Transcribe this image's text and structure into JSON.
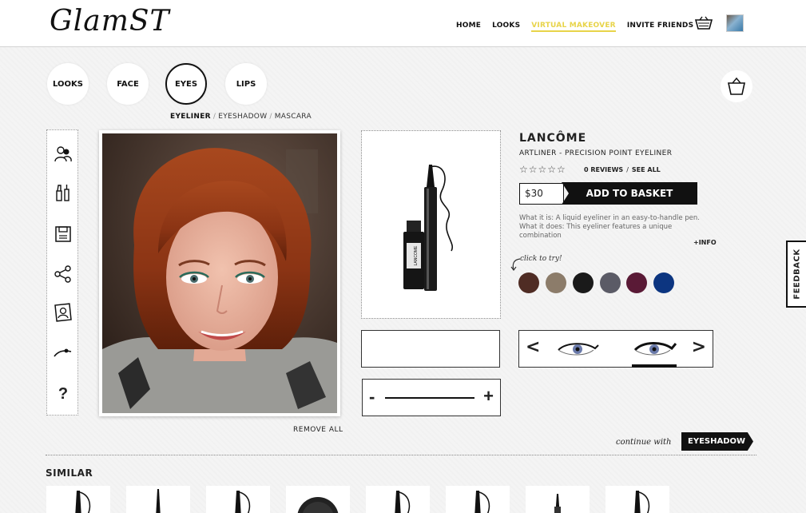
{
  "header": {
    "logo": "GlamST",
    "nav": [
      "HOME",
      "LOOKS",
      "VIRTUAL MAKEOVER",
      "INVITE FRIENDS"
    ],
    "active_nav": "VIRTUAL MAKEOVER"
  },
  "categories": [
    "LOOKS",
    "FACE",
    "EYES",
    "LIPS"
  ],
  "active_category": "EYES",
  "subtabs": [
    "EYELINER",
    "EYESHADOW",
    "MASCARA"
  ],
  "active_subtab": "EYELINER",
  "tools": [
    "users-icon",
    "makeup-icon",
    "save-icon",
    "share-icon",
    "portrait-icon",
    "eyeliner-icon",
    "help-icon"
  ],
  "tools_help": "?",
  "remove_all": "REMOVE ALL",
  "product": {
    "brand": "LANCÔME",
    "name": "ARTLINER - PRECISION POINT EYELINER",
    "stars": "☆☆☆☆☆",
    "reviews": "0 REVIEWS",
    "reviews_sep": "/",
    "see_all": "SEE ALL",
    "price": "$30",
    "add_to_basket": "ADD TO BASKET",
    "desc1": "What it is: A liquid eyeliner in an easy-to-handle pen.",
    "desc2": "What it does: This eyeliner features a unique combination",
    "more_info": "+INFO",
    "click_to_try": "click to try!",
    "swatches": [
      "#4f2c24",
      "#8c7c6a",
      "#1a1a1a",
      "#5b5b66",
      "#5a1a36",
      "#0c3580"
    ]
  },
  "slider": {
    "minus": "-",
    "plus": "+"
  },
  "eye_selector": {
    "prev": "<",
    "next": ">"
  },
  "feedback": "FEEDBACK",
  "continue": {
    "label": "continue with",
    "button": "EYESHADOW"
  },
  "similar_title": "SIMILAR"
}
